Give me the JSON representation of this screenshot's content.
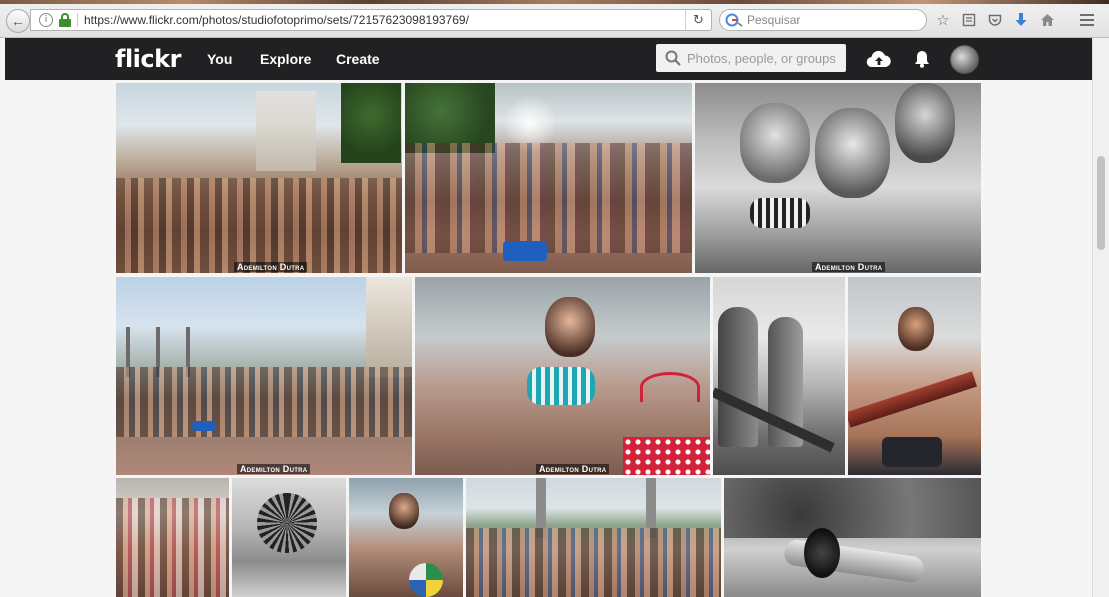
{
  "browser": {
    "url": "https://www.flickr.com/photos/studiofotoprimo/sets/72157623098193769/",
    "search_placeholder": "Pesquisar"
  },
  "header": {
    "logo": "flickr",
    "nav": [
      {
        "label": "You"
      },
      {
        "label": "Explore"
      },
      {
        "label": "Create"
      }
    ],
    "search_placeholder": "Photos, people, or groups"
  },
  "photos": {
    "watermark": "Ademilton Dutra",
    "rows": [
      [
        {
          "name": "photo-plaza-crowd-statue",
          "style": "color"
        },
        {
          "name": "photo-crowd-water-spray",
          "style": "color"
        },
        {
          "name": "photo-women-laughing-bw",
          "style": "bw"
        }
      ],
      [
        {
          "name": "photo-plaza-wide-crowd",
          "style": "color"
        },
        {
          "name": "photo-woman-bikini-sunglasses",
          "style": "color"
        },
        {
          "name": "photo-men-fire-hose-bw",
          "style": "bw"
        },
        {
          "name": "photo-man-fire-hose-color",
          "style": "color"
        }
      ],
      [
        {
          "name": "photo-crowd-women-dancing",
          "style": "color"
        },
        {
          "name": "photo-wet-hair-bw",
          "style": "bw"
        },
        {
          "name": "photo-young-man-ball",
          "style": "color"
        },
        {
          "name": "photo-crowd-fountain-plaza",
          "style": "color"
        },
        {
          "name": "photo-hose-closeup-bw",
          "style": "bw"
        }
      ]
    ]
  }
}
